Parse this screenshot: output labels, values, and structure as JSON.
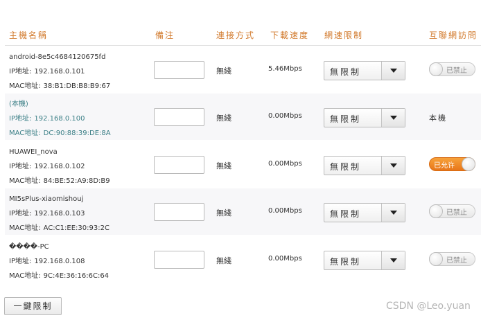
{
  "header": {
    "host_name": "主機名稱",
    "note": "備注",
    "connection_type": "連接方式",
    "download_speed": "下載速度",
    "speed_limit": "網速限制",
    "internet_access": "互聯網訪問"
  },
  "devices": [
    {
      "name": "android-8e5c4684120675fd",
      "ip_label": "IP地址:",
      "ip": "192.168.0.101",
      "mac_label": "MAC地址:",
      "mac": "38:B1:DB:B8:B9:67",
      "note": "",
      "connection": "無綫",
      "speed": "5.46Mbps",
      "limit": "無限制",
      "access": "已禁止",
      "access_state": "off"
    },
    {
      "name": "(本機)",
      "ip_label": "IP地址:",
      "ip": "192.168.0.100",
      "mac_label": "MAC地址:",
      "mac": "DC:90:88:39:DE:8A",
      "note": "",
      "connection": "無綫",
      "speed": "0.00Mbps",
      "limit": "無限制",
      "access": "本機",
      "access_state": "self"
    },
    {
      "name": "HUAWEI_nova",
      "ip_label": "IP地址:",
      "ip": "192.168.0.102",
      "mac_label": "MAC地址:",
      "mac": "84:BE:52:A9:8D:B9",
      "note": "",
      "connection": "無綫",
      "speed": "0.00Mbps",
      "limit": "無限制",
      "access": "已允许",
      "access_state": "on"
    },
    {
      "name": "MI5sPlus-xiaomishouj",
      "ip_label": "IP地址:",
      "ip": "192.168.0.103",
      "mac_label": "MAC地址:",
      "mac": "AC:C1:EE:30:93:2C",
      "note": "",
      "connection": "無綫",
      "speed": "0.00Mbps",
      "limit": "無限制",
      "access": "已禁止",
      "access_state": "off"
    },
    {
      "name": "����-PC",
      "ip_label": "IP地址:",
      "ip": "192.168.0.108",
      "mac_label": "MAC地址:",
      "mac": "9C:4E:36:16:6C:64",
      "note": "",
      "connection": "無綫",
      "speed": "0.00Mbps",
      "limit": "無限制",
      "access": "已禁止",
      "access_state": "off"
    }
  ],
  "footer": {
    "limit_all_label": "一鍵限制"
  },
  "watermark": "CSDN @Leo.yuan",
  "colors": {
    "header_text": "#d27a2c",
    "toggle_on": "#f0891f",
    "self_text": "#3b7f86"
  }
}
